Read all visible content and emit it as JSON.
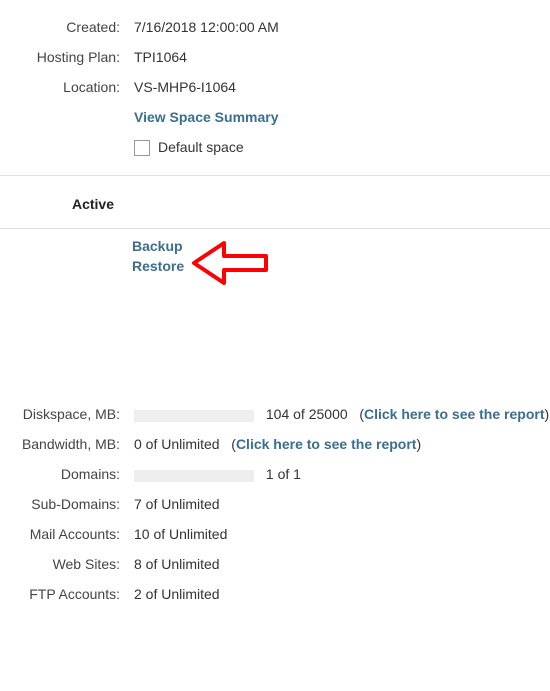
{
  "info": {
    "created_label": "Created:",
    "created_value": "7/16/2018 12:00:00 AM",
    "plan_label": "Hosting Plan:",
    "plan_value": "TPI1064",
    "location_label": "Location:",
    "location_value": "VS-MHP6-I1064",
    "view_summary": "View Space Summary",
    "default_space": "Default space"
  },
  "status": {
    "active_label": "Active"
  },
  "actions": {
    "backup": "Backup",
    "restore": "Restore"
  },
  "stats": {
    "diskspace_label": "Diskspace, MB:",
    "diskspace_value": "104 of 25000",
    "bandwidth_label": "Bandwidth, MB:",
    "bandwidth_value": "0 of Unlimited",
    "domains_label": "Domains:",
    "domains_value": "1 of 1",
    "subdomains_label": "Sub-Domains:",
    "subdomains_value": "7 of Unlimited",
    "mail_label": "Mail Accounts:",
    "mail_value": "10 of Unlimited",
    "websites_label": "Web Sites:",
    "websites_value": "8 of Unlimited",
    "ftp_label": "FTP Accounts:",
    "ftp_value": "2 of Unlimited",
    "report_link": "Click here to see the report"
  }
}
